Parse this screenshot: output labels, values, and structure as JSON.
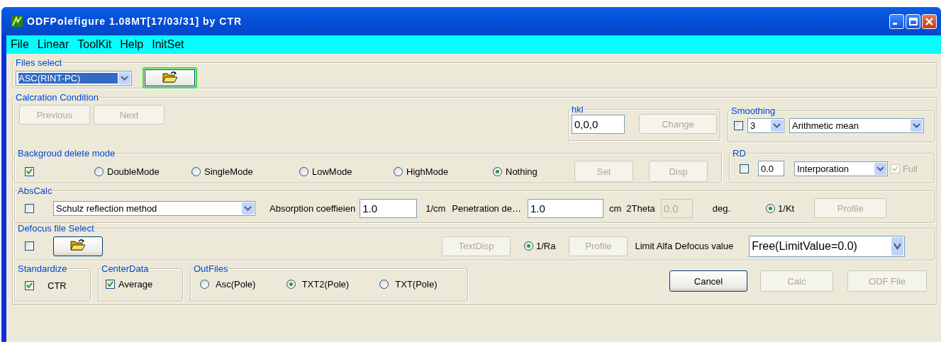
{
  "window": {
    "title": "ODFPolefigure 1.08MT[17/03/31] by CTR"
  },
  "menu": [
    "File",
    "Linear",
    "ToolKit",
    "Help",
    "InitSet"
  ],
  "files_select": {
    "label": "Files select",
    "format": "ASC(RINT-PC)",
    "format_highlighted": true,
    "open_button_focused": true
  },
  "calcration_condition": {
    "label": "Calcration Condition",
    "buttons": [
      {
        "label": "Previous",
        "disabled": true
      },
      {
        "label": "Next",
        "disabled": true
      }
    ],
    "hkl": {
      "label": "hkl",
      "value": "0,0,0",
      "button": {
        "label": "Change",
        "disabled": true
      }
    },
    "smoothing": {
      "label": "Smoothing",
      "checked": false,
      "size": "3",
      "method": "Arithmetic mean"
    },
    "background": {
      "label": "Backgroud delete mode",
      "checked": true,
      "modes": [
        {
          "label": "DoubleMode",
          "selected": false
        },
        {
          "label": "SingleMode",
          "selected": false
        },
        {
          "label": "LowMode",
          "selected": false
        },
        {
          "label": "HighMode",
          "selected": false
        },
        {
          "label": "Nothing",
          "selected": true
        }
      ],
      "buttons": [
        {
          "label": "Set",
          "disabled": true
        },
        {
          "label": "Disp",
          "disabled": true
        }
      ]
    },
    "rd": {
      "label": "RD",
      "checked": false,
      "value": "0.0",
      "method": "Interporation",
      "full": {
        "label": "Full",
        "checked": true,
        "disabled": true
      }
    },
    "abs_calc": {
      "label": "AbsCalc",
      "checked": false,
      "method": "Schulz reflection method",
      "absorption_label": "Absorption coeffieien",
      "absorption": "1.0",
      "absorption_unit": "1/cm",
      "penetration_label": "Penetration de…",
      "penetration": "1.0",
      "penetration_unit": "cm",
      "two_theta_label": "2Theta",
      "two_theta": "0.0",
      "two_theta_disabled": true,
      "two_theta_unit": "deg.",
      "kt": {
        "label": "1/Kt",
        "selected": true
      },
      "profile": {
        "label": "Profile",
        "disabled": true
      }
    },
    "defocus": {
      "label": "Defocus file Select",
      "checked": false,
      "textdisp": {
        "label": "TextDisp",
        "disabled": true
      },
      "ra": {
        "label": "1/Ra",
        "selected": true
      },
      "profile": {
        "label": "Profile",
        "disabled": true
      },
      "limit_label": "Limit Alfa Defocus value",
      "limit": "Free(LimitValue=0.0)"
    },
    "standardize": {
      "label": "Standardize",
      "checked": true,
      "option": "CTR"
    },
    "center_data": {
      "label": "CenterData",
      "checked": true,
      "option": "Average"
    },
    "out_files": {
      "label": "OutFiles",
      "options": [
        {
          "label": "Asc(Pole)",
          "selected": false
        },
        {
          "label": "TXT2(Pole)",
          "selected": true
        },
        {
          "label": "TXT(Pole)",
          "selected": false
        }
      ]
    },
    "actions": [
      {
        "label": "Cancel",
        "disabled": false
      },
      {
        "label": "Calc",
        "disabled": true
      },
      {
        "label": "ODF File",
        "disabled": true
      }
    ]
  }
}
